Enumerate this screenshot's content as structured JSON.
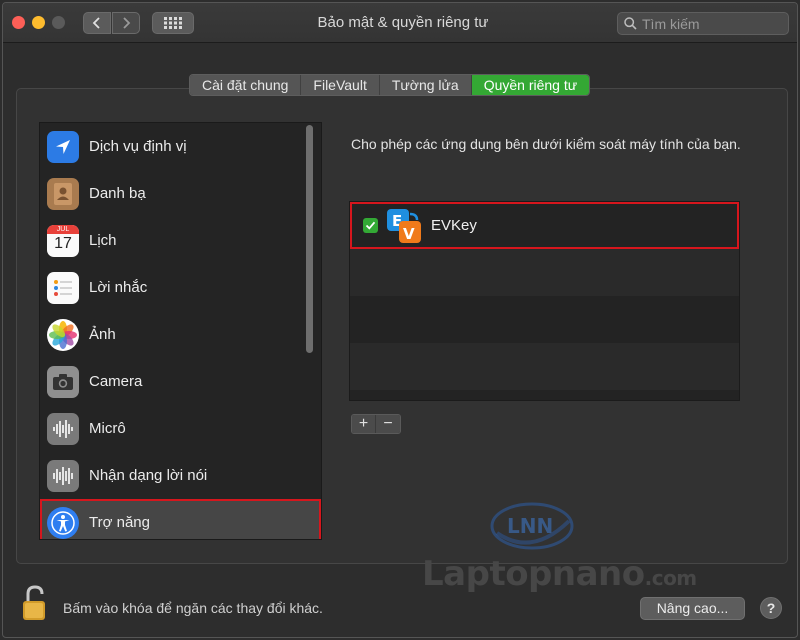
{
  "window": {
    "title": "Bảo mật & quyền riêng tư"
  },
  "search": {
    "placeholder": "Tìm kiếm"
  },
  "tabs": [
    {
      "label": "Cài đặt chung",
      "active": false
    },
    {
      "label": "FileVault",
      "active": false
    },
    {
      "label": "Tường lửa",
      "active": false
    },
    {
      "label": "Quyền riêng tư",
      "active": true
    }
  ],
  "sidebar": {
    "items": [
      {
        "label": "Dịch vụ định vị",
        "icon": "location-arrow-icon"
      },
      {
        "label": "Danh bạ",
        "icon": "contacts-book-icon"
      },
      {
        "label": "Lịch",
        "icon": "calendar-icon",
        "calendar_month": "JUL",
        "calendar_day": "17"
      },
      {
        "label": "Lời nhắc",
        "icon": "reminders-icon"
      },
      {
        "label": "Ảnh",
        "icon": "photos-icon"
      },
      {
        "label": "Camera",
        "icon": "camera-icon"
      },
      {
        "label": "Micrô",
        "icon": "microphone-waveform-icon"
      },
      {
        "label": "Nhận dạng lời nói",
        "icon": "speech-waveform-icon"
      },
      {
        "label": "Trợ năng",
        "icon": "accessibility-icon",
        "selected": true
      }
    ]
  },
  "main": {
    "description": "Cho phép các ứng dụng bên dưới kiểm soát máy tính của bạn.",
    "apps": [
      {
        "name": "EVKey",
        "checked": true,
        "icon": "evkey-app-icon"
      }
    ],
    "add_label": "+",
    "remove_label": "−"
  },
  "watermark": {
    "logo_text": "LNN",
    "name": "Laptopnano",
    "suffix": ".com"
  },
  "footer": {
    "lock_text": "Bấm vào khóa để ngăn các thay đổi khác.",
    "advanced_label": "Nâng cao...",
    "help_label": "?"
  },
  "colors": {
    "accent_green": "#34a834",
    "highlight_red": "#d6161d"
  }
}
